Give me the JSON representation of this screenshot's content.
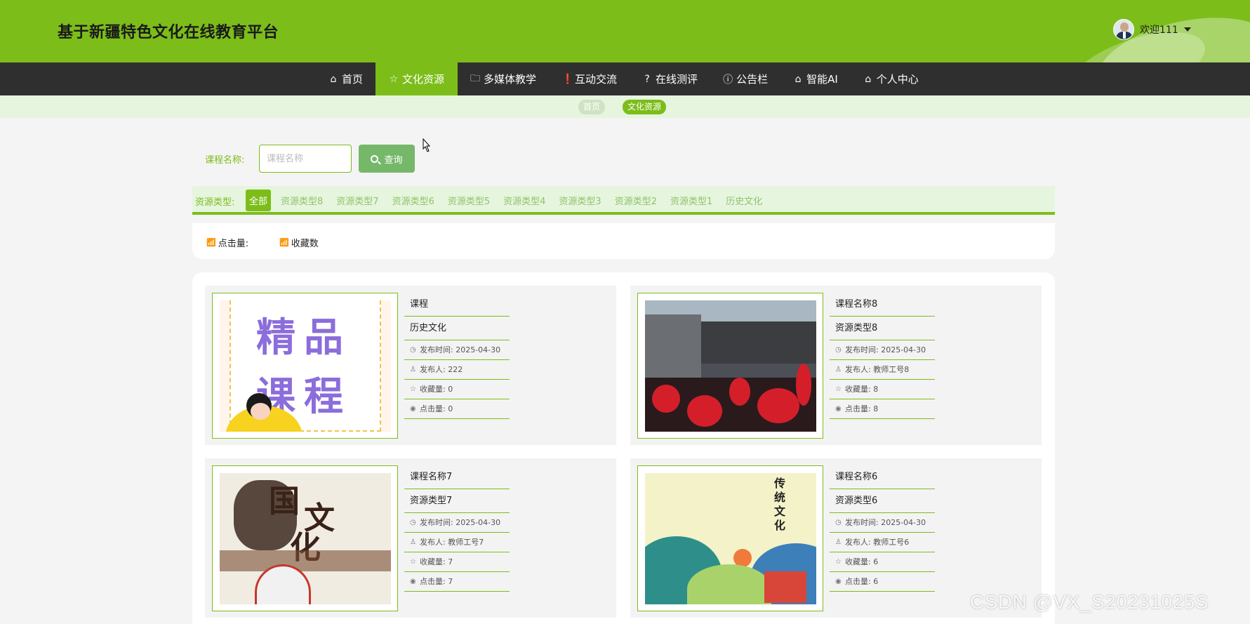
{
  "header": {
    "site_title": "基于新疆特色文化在线教育平台",
    "user_name": "欢迎111"
  },
  "nav": {
    "items": [
      {
        "label": "首页",
        "icon": "home-icon"
      },
      {
        "label": "文化资源",
        "icon": "star-icon",
        "active": true
      },
      {
        "label": "多媒体教学",
        "icon": "bag-icon"
      },
      {
        "label": "互动交流",
        "icon": "alert-icon"
      },
      {
        "label": "在线测评",
        "icon": "help-icon"
      },
      {
        "label": "公告栏",
        "icon": "info-icon"
      },
      {
        "label": "智能AI",
        "icon": "home-icon"
      },
      {
        "label": "个人中心",
        "icon": "home-icon"
      }
    ]
  },
  "breadcrumb": {
    "home": "首页",
    "current": "文化资源"
  },
  "search": {
    "label": "课程名称:",
    "placeholder": "课程名称",
    "value": "",
    "button_label": "查询"
  },
  "type_filter": {
    "label": "资源类型:",
    "options": [
      "全部",
      "资源类型8",
      "资源类型7",
      "资源类型6",
      "资源类型5",
      "资源类型4",
      "资源类型3",
      "资源类型2",
      "资源类型1",
      "历史文化"
    ],
    "selected": "全部"
  },
  "sort": {
    "clicks_label": "点击量:",
    "favorites_label": "收藏数"
  },
  "courses": [
    {
      "title": "课程",
      "type": "历史文化",
      "publish_time": "发布时间: 2025-04-30",
      "publisher": "发布人: 222",
      "favorites": "收藏量: 0",
      "clicks": "点击量: 0",
      "image_text": [
        "精品",
        "课程"
      ]
    },
    {
      "title": "课程名称8",
      "type": "资源类型8",
      "publish_time": "发布时间: 2025-04-30",
      "publisher": "发布人: 教师工号8",
      "favorites": "收藏量: 8",
      "clicks": "点击量: 8"
    },
    {
      "title": "课程名称7",
      "type": "资源类型7",
      "publish_time": "发布时间: 2025-04-30",
      "publisher": "发布人: 教师工号7",
      "favorites": "收藏量: 7",
      "clicks": "点击量: 7",
      "image_text": [
        "国",
        "文",
        "化"
      ]
    },
    {
      "title": "课程名称6",
      "type": "资源类型6",
      "publish_time": "发布时间: 2025-04-30",
      "publisher": "发布人: 教师工号6",
      "favorites": "收藏量: 6",
      "clicks": "点击量: 6",
      "image_text": [
        "传统文化"
      ]
    }
  ],
  "watermark": "CSDN @VX_S20231025S",
  "colors": {
    "brand_green": "#7cbd1a",
    "nav_dark": "#2f2f2f",
    "light_green": "#e6f5de"
  }
}
